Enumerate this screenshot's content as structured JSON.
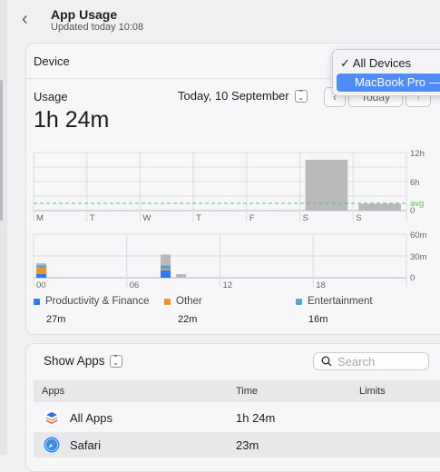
{
  "header": {
    "title": "App Usage",
    "subtitle": "Updated today 10:08"
  },
  "device": {
    "label": "Device",
    "menu": {
      "options": [
        "✓ All Devices",
        "MacBook Pro —"
      ],
      "selected": "All Devices"
    }
  },
  "usage": {
    "label": "Usage",
    "total": "1h 24m",
    "date": "Today, 10 September",
    "today_button": "Today"
  },
  "colors": {
    "productivity": "#3478f6",
    "other": "#f0932b",
    "entertainment": "#5ba1c8",
    "bar_gray": "#b9b9bb",
    "avg_line": "#5fc35f",
    "accent": "#4f8cf5"
  },
  "weekly_chart": {
    "days": [
      "M",
      "T",
      "W",
      "T",
      "F",
      "S",
      "S"
    ],
    "y_ticks": [
      "12h",
      "6h",
      "0"
    ],
    "avg_label": "avg",
    "values_hours": [
      0,
      0,
      0,
      0,
      0,
      10.5,
      1.4
    ],
    "avg_hours": 1.5
  },
  "hourly_chart": {
    "x_ticks": [
      "00",
      "06",
      "12",
      "18"
    ],
    "y_ticks": [
      "60m",
      "30m",
      "0"
    ],
    "bars": [
      {
        "hour": 0,
        "productivity": 5,
        "other": 9,
        "entertainment": 3,
        "gray": 3
      },
      {
        "hour": 8,
        "productivity": 10,
        "other": 2,
        "entertainment": 5,
        "gray": 15
      },
      {
        "hour": 9,
        "productivity": 0,
        "other": 0,
        "entertainment": 0,
        "gray": 5
      }
    ]
  },
  "legend": [
    {
      "name": "Productivity & Finance",
      "value": "27m",
      "color": "#3478f6"
    },
    {
      "name": "Other",
      "value": "22m",
      "color": "#f0932b"
    },
    {
      "name": "Entertainment",
      "value": "16m",
      "color": "#5ba1c8"
    }
  ],
  "apps": {
    "show_label": "Show Apps",
    "search_placeholder": "Search",
    "columns": [
      "Apps",
      "Time",
      "Limits"
    ],
    "rows": [
      {
        "name": "All Apps",
        "time": "1h 24m",
        "icon": "layers-icon"
      },
      {
        "name": "Safari",
        "time": "23m",
        "icon": "compass-icon"
      }
    ]
  }
}
